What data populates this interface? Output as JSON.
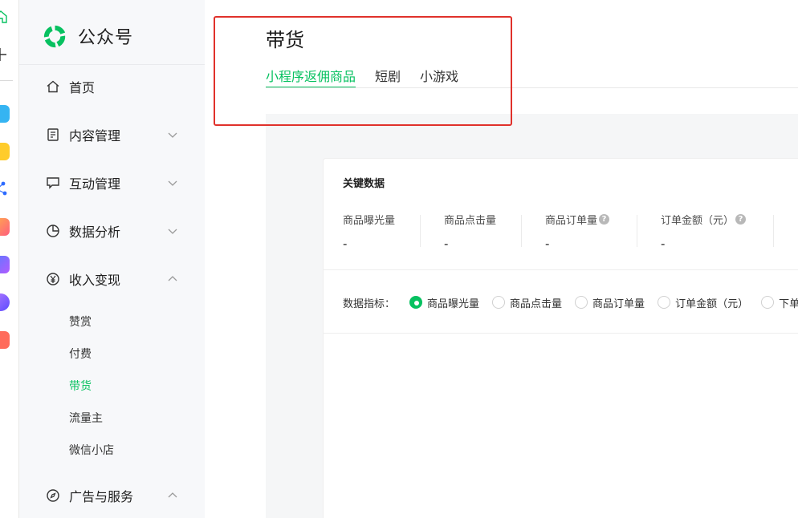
{
  "brand": {
    "name": "公众号"
  },
  "nav": {
    "home": {
      "label": "首页"
    },
    "content": {
      "label": "内容管理"
    },
    "interaction": {
      "label": "互动管理"
    },
    "analytics": {
      "label": "数据分析"
    },
    "monetization": {
      "label": "收入变现",
      "children": [
        {
          "label": "赞赏"
        },
        {
          "label": "付费"
        },
        {
          "label": "带货",
          "active": true
        },
        {
          "label": "流量主"
        },
        {
          "label": "微信小店"
        }
      ]
    },
    "ads": {
      "label": "广告与服务"
    }
  },
  "page": {
    "title": "带货",
    "tabs": [
      {
        "label": "小程序返佣商品",
        "active": true
      },
      {
        "label": "短剧"
      },
      {
        "label": "小游戏"
      }
    ]
  },
  "key_data": {
    "title": "关键数据",
    "metrics": [
      {
        "label": "商品曝光量",
        "value": "-"
      },
      {
        "label": "商品点击量",
        "value": "-"
      },
      {
        "label": "商品订单量",
        "value": "-",
        "help": "?"
      },
      {
        "label": "订单金额（元）",
        "value": "-",
        "help": "?"
      }
    ]
  },
  "indicator": {
    "label": "数据指标：",
    "options": [
      {
        "label": "商品曝光量",
        "checked": true
      },
      {
        "label": "商品点击量"
      },
      {
        "label": "商品订单量"
      },
      {
        "label": "订单金额（元）"
      },
      {
        "label": "下单率"
      }
    ]
  },
  "colors": {
    "accent": "#07c160",
    "highlight": "#e0312b"
  }
}
